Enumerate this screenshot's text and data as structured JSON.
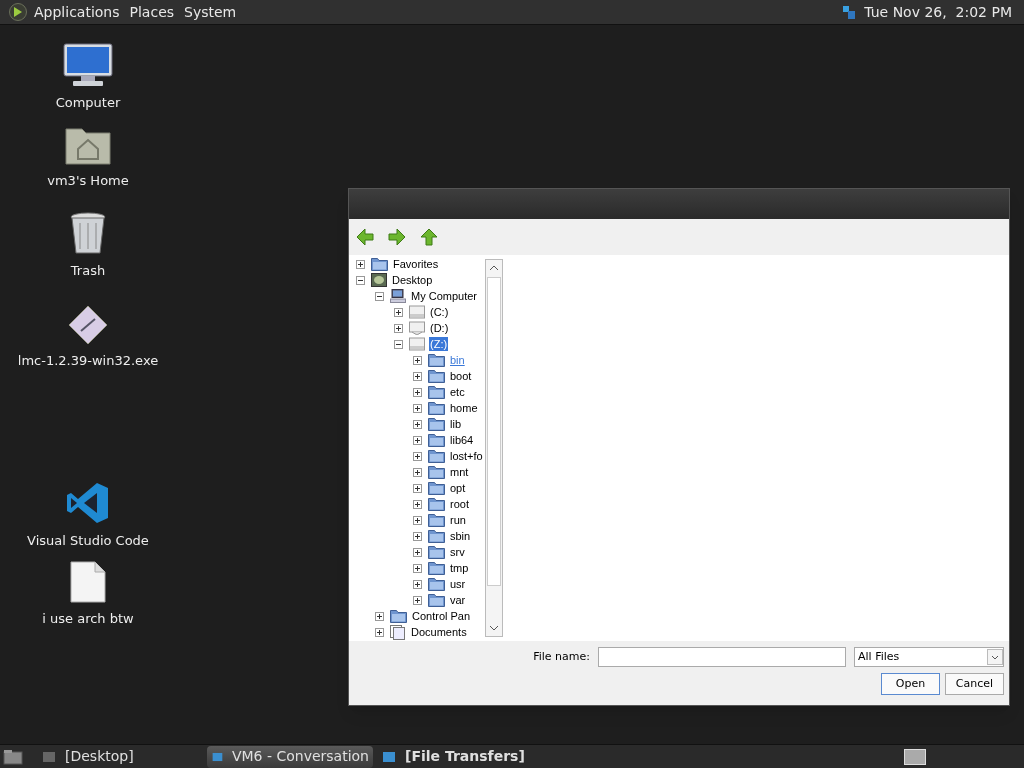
{
  "top_panel": {
    "menus": [
      "Applications",
      "Places",
      "System"
    ],
    "clock": "Tue Nov 26,  2:02 PM"
  },
  "desktop_icons": [
    {
      "label": "Computer",
      "kind": "computer"
    },
    {
      "label": "vm3's Home",
      "kind": "home"
    },
    {
      "label": "Trash",
      "kind": "trash"
    },
    {
      "label": "lmc-1.2.39-win32.exe",
      "kind": "exe"
    },
    {
      "label": "Visual Studio Code",
      "kind": "vscode"
    },
    {
      "label": "i use arch btw",
      "kind": "file"
    }
  ],
  "dialog": {
    "tree": [
      {
        "label": "Favorites",
        "kind": "folder",
        "expanded": false,
        "selected": false
      },
      {
        "label": "Desktop",
        "kind": "desktop",
        "expanded": true,
        "selected": false,
        "children": [
          {
            "label": "My Computer",
            "kind": "computer",
            "expanded": true,
            "selected": false,
            "children": [
              {
                "label": "(C:)",
                "kind": "drive",
                "expanded": false,
                "selected": false
              },
              {
                "label": "(D:)",
                "kind": "cdrom",
                "expanded": false,
                "selected": false
              },
              {
                "label": "(Z:)",
                "kind": "drive",
                "expanded": true,
                "selected": true,
                "children": [
                  {
                    "label": "bin",
                    "kind": "folder",
                    "expanded": false,
                    "selected": false,
                    "hovered": true
                  },
                  {
                    "label": "boot",
                    "kind": "folder",
                    "expanded": false,
                    "selected": false
                  },
                  {
                    "label": "etc",
                    "kind": "folder",
                    "expanded": false,
                    "selected": false
                  },
                  {
                    "label": "home",
                    "kind": "folder",
                    "expanded": false,
                    "selected": false
                  },
                  {
                    "label": "lib",
                    "kind": "folder",
                    "expanded": false,
                    "selected": false
                  },
                  {
                    "label": "lib64",
                    "kind": "folder",
                    "expanded": false,
                    "selected": false
                  },
                  {
                    "label": "lost+fo",
                    "kind": "folder",
                    "expanded": false,
                    "selected": false
                  },
                  {
                    "label": "mnt",
                    "kind": "folder",
                    "expanded": false,
                    "selected": false
                  },
                  {
                    "label": "opt",
                    "kind": "folder",
                    "expanded": false,
                    "selected": false
                  },
                  {
                    "label": "root",
                    "kind": "folder",
                    "expanded": false,
                    "selected": false
                  },
                  {
                    "label": "run",
                    "kind": "folder",
                    "expanded": false,
                    "selected": false
                  },
                  {
                    "label": "sbin",
                    "kind": "folder",
                    "expanded": false,
                    "selected": false
                  },
                  {
                    "label": "srv",
                    "kind": "folder",
                    "expanded": false,
                    "selected": false
                  },
                  {
                    "label": "tmp",
                    "kind": "folder",
                    "expanded": false,
                    "selected": false
                  },
                  {
                    "label": "usr",
                    "kind": "folder",
                    "expanded": false,
                    "selected": false
                  },
                  {
                    "label": "var",
                    "kind": "folder",
                    "expanded": false,
                    "selected": false
                  }
                ]
              }
            ]
          },
          {
            "label": "Control Pan",
            "kind": "folder",
            "expanded": false,
            "selected": false
          },
          {
            "label": "Documents",
            "kind": "documents",
            "expanded": false,
            "selected": false
          }
        ]
      }
    ],
    "file_name_label": "File name:",
    "file_type": "All Files",
    "buttons": [
      "Open",
      "Cancel"
    ]
  },
  "taskbar": {
    "tasks": [
      {
        "label": "[Desktop]",
        "selected": false,
        "bold": false
      },
      {
        "label": "VM6 - Conversation",
        "selected": true,
        "bold": false
      },
      {
        "label": "[File Transfers]",
        "selected": false,
        "bold": true
      }
    ]
  }
}
